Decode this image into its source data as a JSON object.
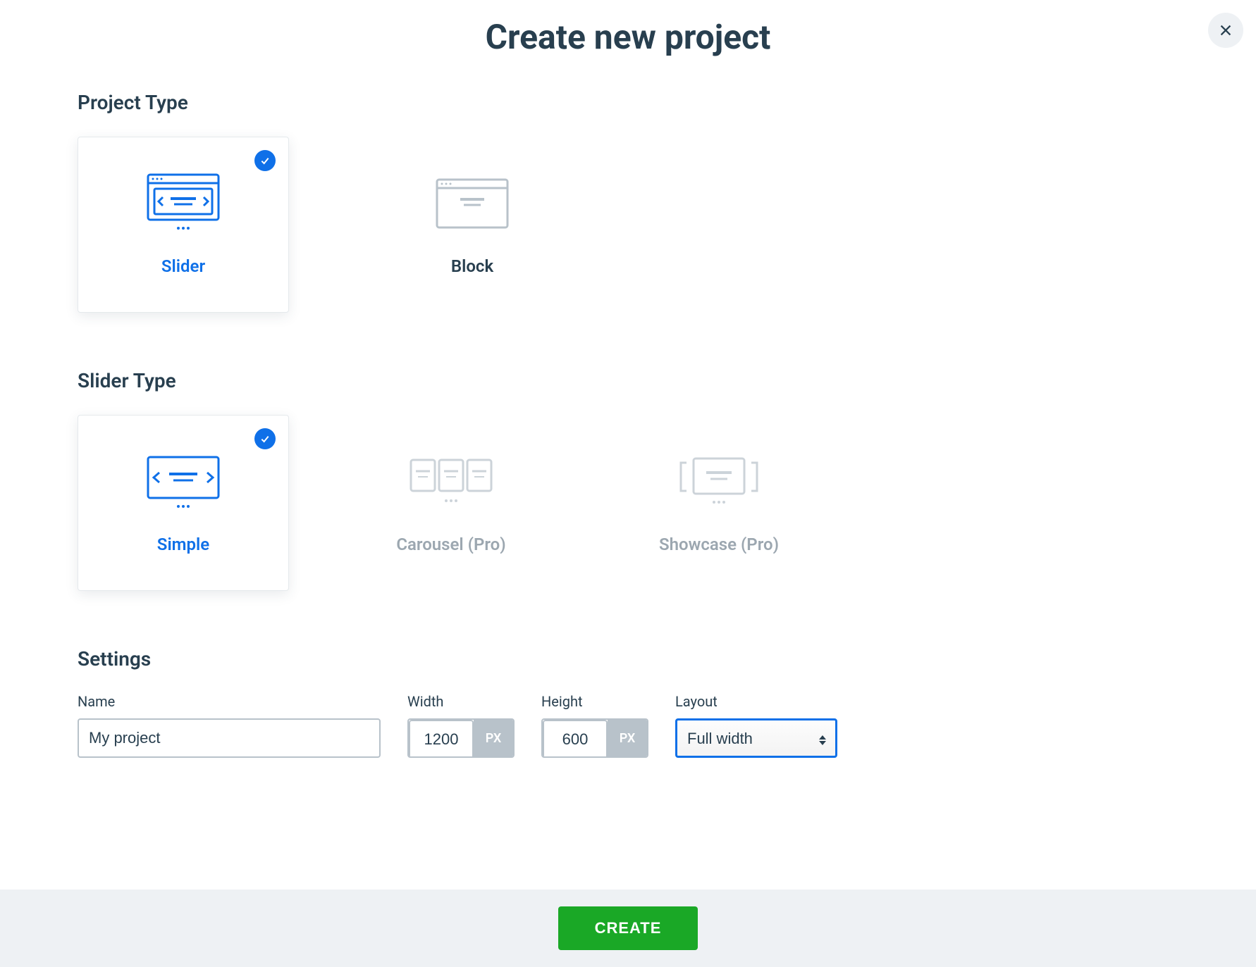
{
  "modal": {
    "title": "Create new project",
    "close_aria": "Close"
  },
  "sections": {
    "project_type": {
      "heading": "Project Type",
      "options": [
        {
          "label": "Slider",
          "selected": true
        },
        {
          "label": "Block",
          "selected": false
        }
      ]
    },
    "slider_type": {
      "heading": "Slider Type",
      "options": [
        {
          "label": "Simple",
          "selected": true,
          "disabled": false
        },
        {
          "label": "Carousel (Pro)",
          "selected": false,
          "disabled": true
        },
        {
          "label": "Showcase (Pro)",
          "selected": false,
          "disabled": true
        }
      ]
    },
    "settings": {
      "heading": "Settings",
      "name": {
        "label": "Name",
        "value": "My project"
      },
      "width": {
        "label": "Width",
        "value": "1200",
        "unit": "PX"
      },
      "height": {
        "label": "Height",
        "value": "600",
        "unit": "PX"
      },
      "layout": {
        "label": "Layout",
        "value": "Full width"
      }
    }
  },
  "footer": {
    "create_label": "CREATE"
  },
  "colors": {
    "accent": "#0f70e8",
    "success": "#1aa826",
    "text": "#283f4f",
    "muted": "#9ca7b0",
    "border": "#b8c2ca"
  }
}
